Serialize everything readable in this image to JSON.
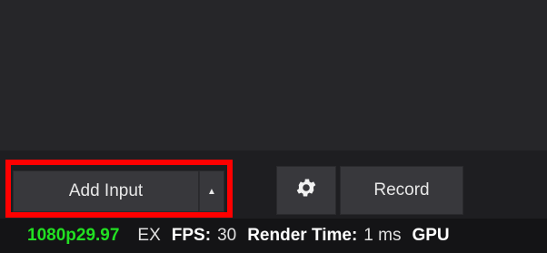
{
  "toolbar": {
    "add_input_label": "Add Input",
    "add_input_arrow": "▲",
    "record_label": "Record",
    "settings_icon": "gear-icon"
  },
  "status": {
    "format": "1080p29.97",
    "ex": "EX",
    "fps_label": "FPS:",
    "fps_value": "30",
    "render_label": "Render Time:",
    "render_value": "1 ms",
    "gpu_label": "GPU"
  },
  "colors": {
    "highlight": "#ff0000",
    "format_text": "#22e022",
    "background": "#222225"
  }
}
